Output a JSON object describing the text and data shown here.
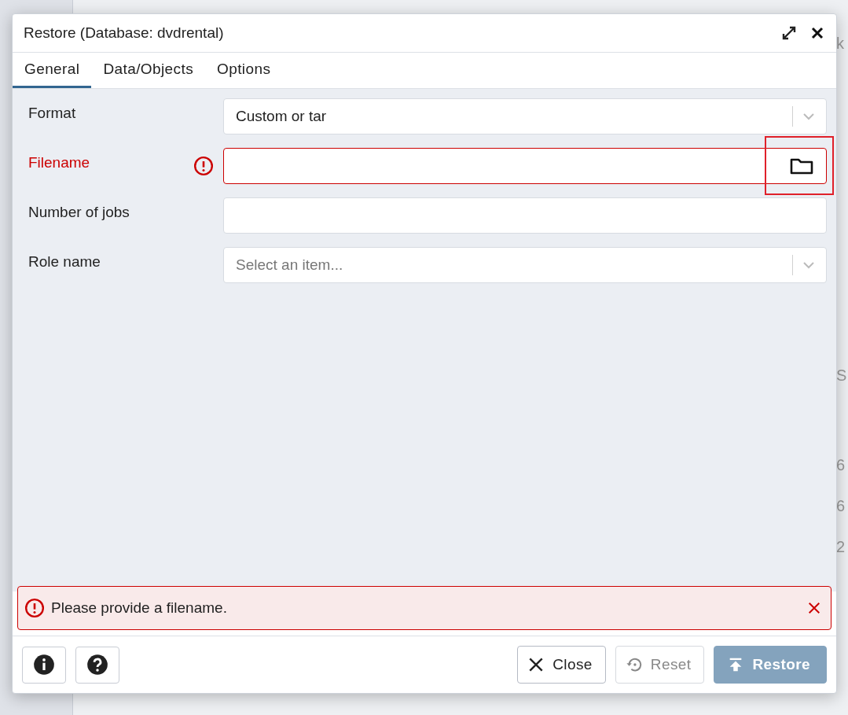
{
  "background_fragments": [
    "k",
    "S",
    "6",
    "6",
    "2"
  ],
  "dialog": {
    "title": "Restore (Database: dvdrental)"
  },
  "tabs": [
    {
      "label": "General",
      "selected": true
    },
    {
      "label": "Data/Objects",
      "selected": false
    },
    {
      "label": "Options",
      "selected": false
    }
  ],
  "fields": [
    {
      "kind": "select",
      "label": "Format",
      "value": "Custom or tar",
      "error": false
    },
    {
      "kind": "file",
      "label": "Filename",
      "error": true,
      "highlighted": true
    },
    {
      "kind": "text",
      "label": "Number of jobs",
      "error": false
    },
    {
      "kind": "select",
      "label": "Role name",
      "placeholder": "Select an item...",
      "error": false
    }
  ],
  "error_message": "Please provide a filename.",
  "buttons": [
    {
      "kind": "close",
      "label": "Close",
      "disabled": false
    },
    {
      "kind": "reset",
      "label": "Reset",
      "disabled": true
    },
    {
      "kind": "restore",
      "label": "Restore",
      "disabled": true
    }
  ]
}
